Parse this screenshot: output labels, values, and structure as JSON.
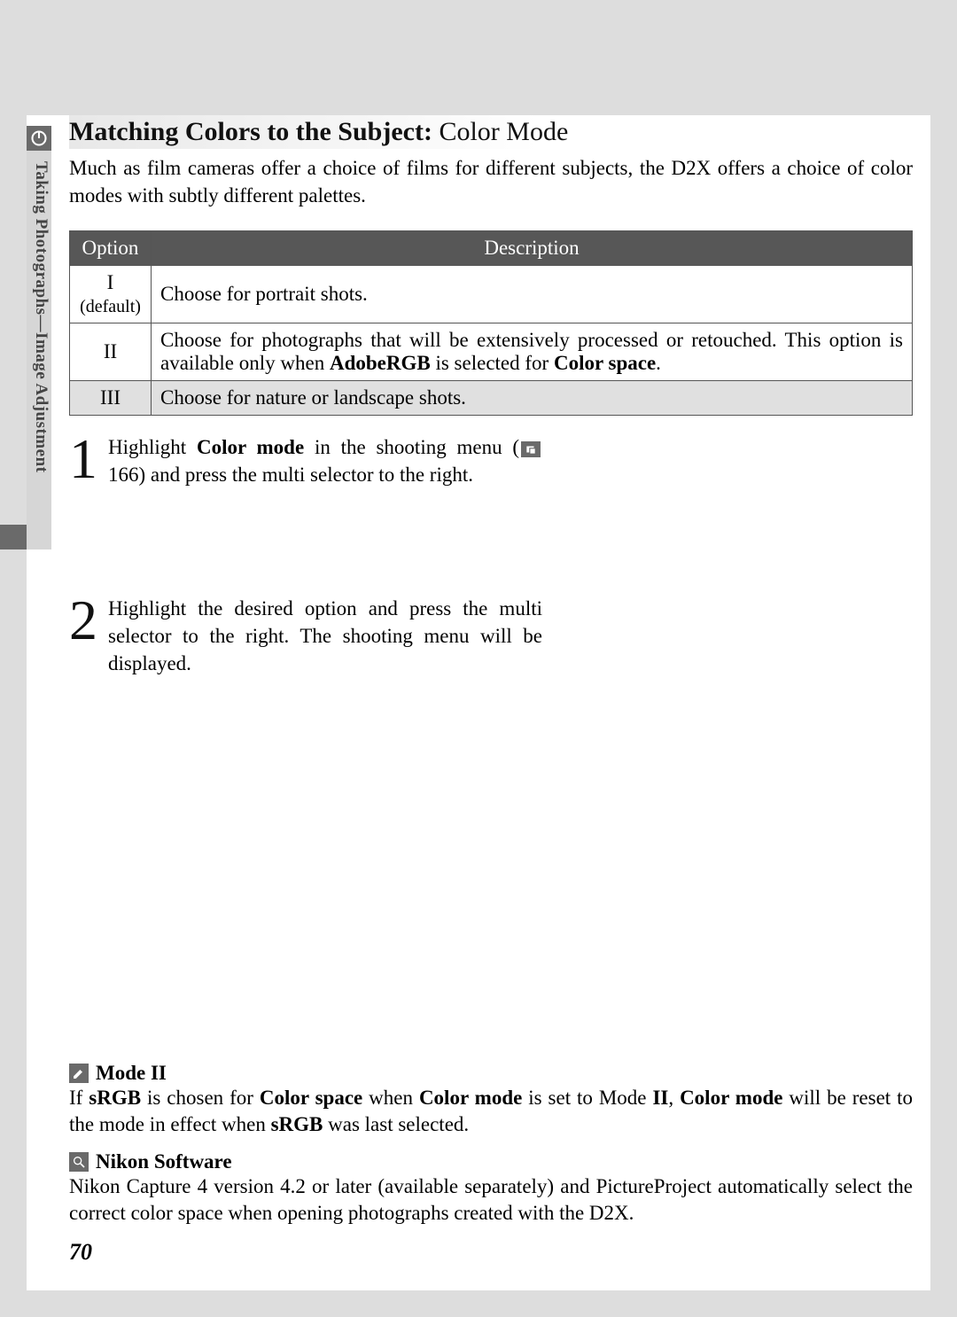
{
  "side_tab_label": "Taking Photographs—Image Adjustment",
  "heading": {
    "bold": "Matching Colors to the Subject:",
    "rest": " Color Mode"
  },
  "intro": "Much as film cameras offer a choice of films for different subjects, the D2X offers a choice of color modes with subtly different palettes.",
  "table": {
    "headers": {
      "option": "Option",
      "description": "Description"
    },
    "rows": [
      {
        "option": "I",
        "sub": "(default)",
        "desc": "Choose for portrait shots.",
        "alt": false
      },
      {
        "option": "II",
        "sub": "",
        "desc_parts": {
          "p1": "Choose for photographs that will be extensively processed or retouched. This option is available only when ",
          "b1": "AdobeRGB",
          "p2": " is selected for ",
          "b2": "Color space",
          "p3": "."
        },
        "alt": false,
        "justify": true
      },
      {
        "option": "III",
        "sub": "",
        "desc": "Choose for nature or landscape shots.",
        "alt": true
      }
    ]
  },
  "steps": [
    {
      "num": "1",
      "parts": {
        "p1": "Highlight ",
        "b1": "Color mode",
        "p2": " in the shooting menu (",
        "ref": " 166) and press the multi selector to the right."
      }
    },
    {
      "num": "2",
      "text": "Highlight the desired option and press the multi selector to the right. The shooting menu will be displayed."
    }
  ],
  "notes": {
    "mode2": {
      "title": "Mode II",
      "parts": {
        "p1": "If ",
        "b1": "sRGB",
        "p2": " is chosen for ",
        "b2": "Color space",
        "p3": " when ",
        "b3": "Color mode",
        "p4": " is set to Mode ",
        "b4": "II",
        "p5": ", ",
        "b5": "Color mode",
        "p6": " will be reset to the mode in effect when ",
        "b6": "sRGB",
        "p7": " was last selected."
      }
    },
    "nikon": {
      "title": "Nikon Software",
      "text": "Nikon Capture 4 version 4.2 or later (available separately) and PictureProject automatically select the correct color space when opening photographs created with the D2X."
    }
  },
  "page_number": "70"
}
